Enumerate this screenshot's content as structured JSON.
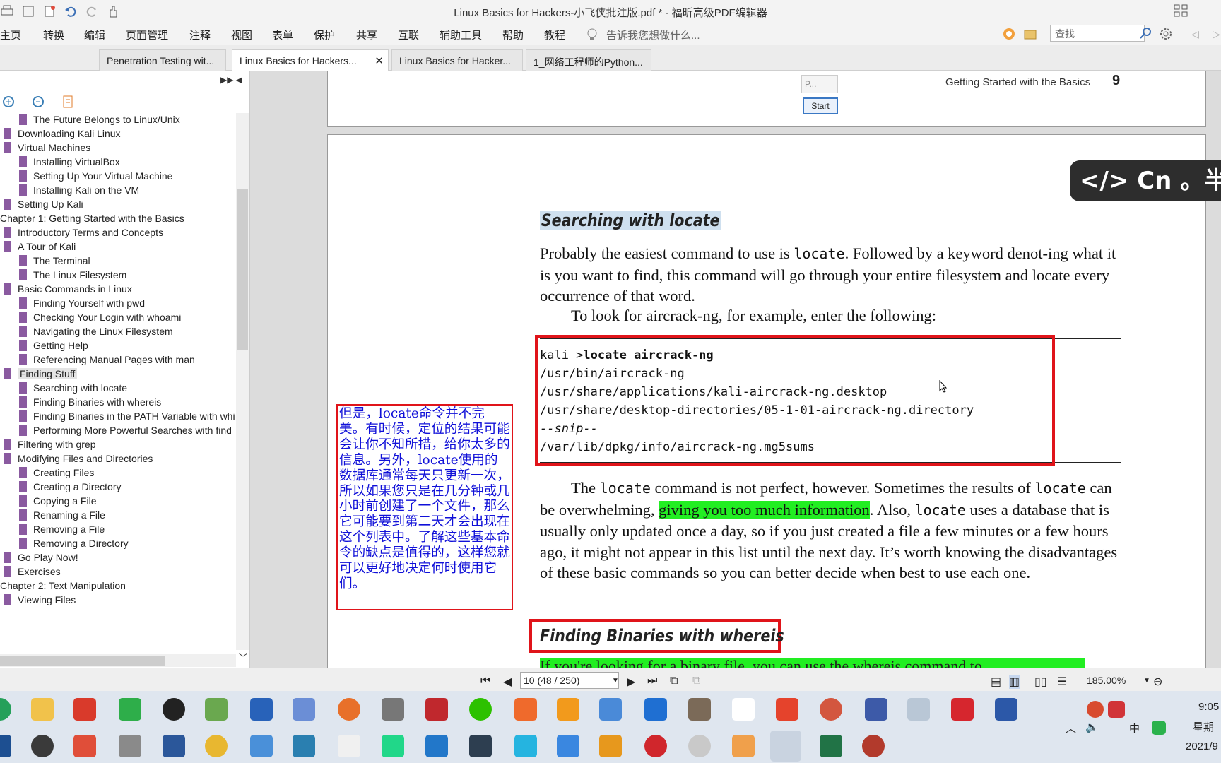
{
  "window": {
    "title": "Linux Basics for Hackers-小飞侠批注版.pdf * - 福昕高级PDF编辑器"
  },
  "menu": [
    "主页",
    "转换",
    "编辑",
    "页面管理",
    "注释",
    "视图",
    "表单",
    "保护",
    "共享",
    "互联",
    "辅助工具",
    "帮助",
    "教程"
  ],
  "tell_me": "告诉我您想做什么...",
  "search_placeholder": "查找",
  "tabs": [
    {
      "label": "Penetration Testing wit...",
      "active": false
    },
    {
      "label": "Linux Basics for Hackers...",
      "active": true
    },
    {
      "label": "Linux Basics for Hacker...",
      "active": false
    },
    {
      "label": "1_网络工程师的Python...",
      "active": false
    }
  ],
  "bookmarks": [
    {
      "label": "The Future Belongs to Linux/Unix",
      "level": 2
    },
    {
      "label": "Downloading Kali Linux",
      "level": 1
    },
    {
      "label": "Virtual Machines",
      "level": 1
    },
    {
      "label": "Installing VirtualBox",
      "level": 2
    },
    {
      "label": "Setting Up Your Virtual Machine",
      "level": 2
    },
    {
      "label": "Installing Kali on the VM",
      "level": 2
    },
    {
      "label": "Setting Up Kali",
      "level": 1
    },
    {
      "label": "Chapter 1: Getting Started with the Basics",
      "level": 0
    },
    {
      "label": "Introductory Terms and Concepts",
      "level": 1
    },
    {
      "label": "A Tour of Kali",
      "level": 1
    },
    {
      "label": "The Terminal",
      "level": 2
    },
    {
      "label": "The Linux Filesystem",
      "level": 2
    },
    {
      "label": "Basic Commands in Linux",
      "level": 1
    },
    {
      "label": "Finding Yourself with pwd",
      "level": 2
    },
    {
      "label": "Checking Your Login with whoami",
      "level": 2
    },
    {
      "label": "Navigating the Linux Filesystem",
      "level": 2
    },
    {
      "label": "Getting Help",
      "level": 2
    },
    {
      "label": "Referencing Manual Pages with man",
      "level": 2
    },
    {
      "label": "Finding Stuff",
      "level": 1,
      "selected": true
    },
    {
      "label": "Searching with locate",
      "level": 2
    },
    {
      "label": "Finding Binaries with whereis",
      "level": 2
    },
    {
      "label": "Finding Binaries in the PATH Variable with whi",
      "level": 2
    },
    {
      "label": "Performing More Powerful Searches with find",
      "level": 2
    },
    {
      "label": "Filtering with grep",
      "level": 1
    },
    {
      "label": "Modifying Files and Directories",
      "level": 1
    },
    {
      "label": "Creating Files",
      "level": 2
    },
    {
      "label": "Creating a Directory",
      "level": 2
    },
    {
      "label": "Copying a File",
      "level": 2
    },
    {
      "label": "Renaming a File",
      "level": 2
    },
    {
      "label": "Removing a File",
      "level": 2
    },
    {
      "label": "Removing a Directory",
      "level": 2
    },
    {
      "label": "Go Play Now!",
      "level": 1
    },
    {
      "label": "Exercises",
      "level": 1
    },
    {
      "label": "Chapter 2: Text Manipulation",
      "level": 0
    },
    {
      "label": "Viewing Files",
      "level": 1
    }
  ],
  "page_prev": {
    "running_head": "Getting Started with the Basics",
    "page_number": "9",
    "field_placeholder": "P...",
    "start_button": "Start"
  },
  "doc": {
    "heading1": "Searching with locate",
    "p1_pre": "Probably the easiest command to use is ",
    "p1_code": "locate",
    "p1_post": ". Followed by a keyword denot-ing what it is you want to find, this command will go through your entire filesystem and locate every occurrence of that word.",
    "p2": "To look for aircrack-ng, for example, enter the following:",
    "code_prompt": "kali >",
    "code_cmd": "locate aircrack-ng",
    "code_lines": [
      "/usr/bin/aircrack-ng",
      "/usr/share/applications/kali-aircrack-ng.desktop",
      "/usr/share/desktop-directories/05-1-01-aircrack-ng.directory",
      "--snip--",
      "/var/lib/dpkg/info/aircrack-ng.mg5sums"
    ],
    "p3_a": "The ",
    "p3_code1": "locate",
    "p3_b": " command is not perfect, however. Sometimes the results of ",
    "p3_code2": "locate",
    "p3_c": " can be overwhelming, ",
    "p3_highlight": "giving you too much information",
    "p3_d": ". Also, ",
    "p3_code3": "locate",
    "p3_e": " uses a database that is usually only updated once a day, so if you just created a file a few minutes or a few hours ago, it might not appear in this list until the next day. It’s worth knowing the disadvantages of these basic commands so you can better decide when best to use each one.",
    "annotation": "但是，locate命令并不完美。有时候，定位的结果可能会让你不知所措，给你太多的信息。另外，locate使用的数据库通常每天只更新一次，所以如果您只是在几分钟或几小时前创建了一个文件，那么它可能要到第二天才会出现在这个列表中。了解这些基本命令的缺点是值得的，这样您就可以更好地决定何时使用它们。",
    "heading2": "Finding Binaries with whereis",
    "next_line": "If you're looking for a binary file, you can use the whereis command to"
  },
  "ime_bar": "</> Cn 。半",
  "status": {
    "page_box": "10 (48 / 250)",
    "zoom": "185.00%"
  },
  "tray": {
    "time": "9:05",
    "weekday": "星期",
    "date": "2021/9",
    "lang": "中"
  },
  "colors": {
    "annotation_border": "#e0141a",
    "annotation_text": "#1010d8",
    "highlight": "#22ee22",
    "bookmark_flag": "#8a5aa0",
    "heading_highlight": "#cfe0ef"
  }
}
